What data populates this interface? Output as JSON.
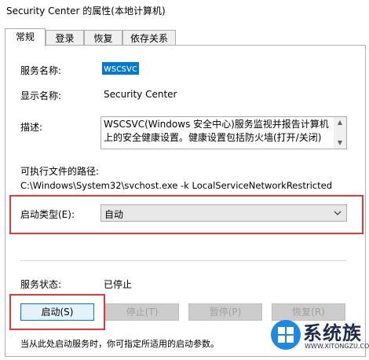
{
  "window": {
    "title": "Security Center 的属性(本地计算机)"
  },
  "tabs": [
    {
      "label": "常规",
      "active": true
    },
    {
      "label": "登录",
      "active": false
    },
    {
      "label": "恢复",
      "active": false
    },
    {
      "label": "依存关系",
      "active": false
    }
  ],
  "general": {
    "service_name_label": "服务名称:",
    "service_name_value": "wscsvc",
    "display_name_label": "显示名称:",
    "display_name_value": "Security Center",
    "description_label": "描述:",
    "description_value": "WSCSVC(Windows 安全中心)服务监视并报告计算机上的安全健康设置。健康设置包括防火墙(打开/关闭)",
    "exe_path_label": "可执行文件的路径:",
    "exe_path_value": "C:\\Windows\\System32\\svchost.exe -k LocalServiceNetworkRestricted",
    "startup_type_label": "启动类型(E):",
    "startup_type_value": "自动",
    "service_status_label": "服务状态:",
    "service_status_value": "已停止",
    "hint_text": "当从此处启动服务时，你可指定所适用的启动参数。"
  },
  "buttons": {
    "start": "启动(S)",
    "stop": "停止(T)",
    "pause": "暂停(P)",
    "resume": "恢复(R)"
  },
  "watermark": {
    "name": "系统族",
    "url": "WWW.XITONGZU.COM"
  },
  "colors": {
    "highlight_red": "#e03a3a",
    "selection_blue": "#0078d7",
    "logo_blue": "#1e88e5"
  }
}
